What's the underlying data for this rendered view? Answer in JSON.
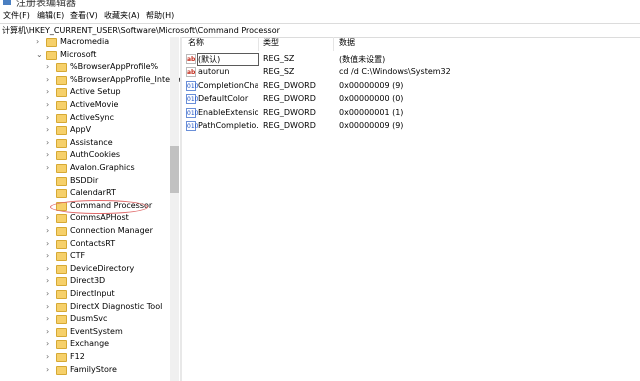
{
  "window": {
    "title": "注册表编辑器"
  },
  "menu": [
    "文件(F)",
    "编辑(E)",
    "查看(V)",
    "收藏夹(A)",
    "帮助(H)"
  ],
  "address": "计算机\\HKEY_CURRENT_USER\\Software\\Microsoft\\Command Processor",
  "tree": [
    {
      "label": "Macromedia",
      "expander": "›"
    },
    {
      "label": "Microsoft",
      "expander": "⌄"
    },
    {
      "label": "%BrowserAppProfile%",
      "expander": "›"
    },
    {
      "label": "%BrowserAppProfile_Interne",
      "expander": "›"
    },
    {
      "label": "Active Setup",
      "expander": "›"
    },
    {
      "label": "ActiveMovie",
      "expander": "›"
    },
    {
      "label": "ActiveSync",
      "expander": "›"
    },
    {
      "label": "AppV",
      "expander": "›"
    },
    {
      "label": "Assistance",
      "expander": "›"
    },
    {
      "label": "AuthCookies",
      "expander": "›"
    },
    {
      "label": "Avalon.Graphics",
      "expander": "›"
    },
    {
      "label": "BSDDir",
      "expander": ""
    },
    {
      "label": "CalendarRT",
      "expander": ""
    },
    {
      "label": "Command Processor",
      "expander": ""
    },
    {
      "label": "CommsAPHost",
      "expander": "›"
    },
    {
      "label": "Connection Manager",
      "expander": "›"
    },
    {
      "label": "ContactsRT",
      "expander": "›"
    },
    {
      "label": "CTF",
      "expander": "›"
    },
    {
      "label": "DeviceDirectory",
      "expander": "›"
    },
    {
      "label": "Direct3D",
      "expander": "›"
    },
    {
      "label": "DirectInput",
      "expander": "›"
    },
    {
      "label": "DirectX Diagnostic Tool",
      "expander": "›"
    },
    {
      "label": "DusmSvc",
      "expander": "›"
    },
    {
      "label": "EventSystem",
      "expander": "›"
    },
    {
      "label": "Exchange",
      "expander": "›"
    },
    {
      "label": "F12",
      "expander": "›"
    },
    {
      "label": "FamilyStore",
      "expander": "›"
    }
  ],
  "columns": {
    "name": "名称",
    "type": "类型",
    "data": "数据"
  },
  "values": [
    {
      "name": "(默认)",
      "type": "REG_SZ",
      "data": "(数值未设置)",
      "kind": "sz",
      "icon": "ab"
    },
    {
      "name": "autorun",
      "type": "REG_SZ",
      "data": "cd /d C:\\Windows\\System32",
      "kind": "sz",
      "icon": "ab"
    },
    {
      "name": "CompletionChar",
      "type": "REG_DWORD",
      "data": "0x00000009 (9)",
      "kind": "dw",
      "icon": "010"
    },
    {
      "name": "DefaultColor",
      "type": "REG_DWORD",
      "data": "0x00000000 (0)",
      "kind": "dw",
      "icon": "010"
    },
    {
      "name": "EnableExtensio",
      "type": "REG_DWORD",
      "data": "0x00000001 (1)",
      "kind": "dw",
      "icon": "010"
    },
    {
      "name": "PathCompletio...",
      "type": "REG_DWORD",
      "data": "0x00000009 (9)",
      "kind": "dw",
      "icon": "010"
    }
  ]
}
